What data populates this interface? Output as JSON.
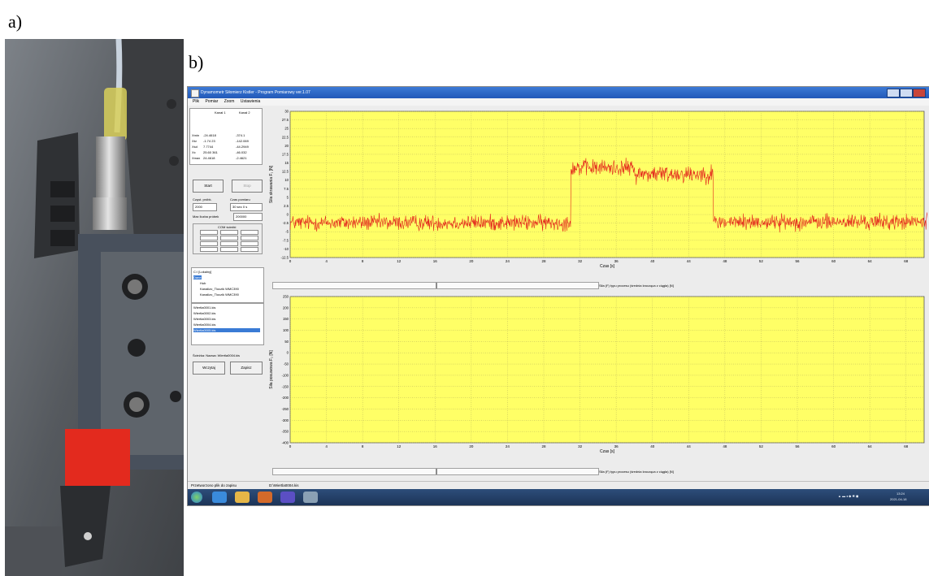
{
  "panels": {
    "a_label": "a)",
    "b_label": "b)"
  },
  "window": {
    "title": "Dynamometr Siłomierz Kistler - Program Pomiarowy  ver.1.07",
    "menu": [
      "Plik",
      "Pomiar",
      "Zoom",
      "Ustawienia"
    ]
  },
  "left_panel": {
    "channel_headers": [
      "Kanał 1",
      "Kanał 2"
    ],
    "stats_rows": [
      {
        "label": "Xmin",
        "ch1": "-24.4618",
        "ch2": "-374.1"
      },
      {
        "label": "Xśr",
        "ch1": "-1.74 23",
        "ch2": "-142.069"
      },
      {
        "label": "Xsd",
        "ch1": "7.7744",
        "ch2": "-44.2949"
      },
      {
        "label": "Xx",
        "ch1": "25.60 361",
        "ch2": "-46.032"
      },
      {
        "label": "Xmax",
        "ch1": "24.4618",
        "ch2": "-2.4621"
      }
    ],
    "start_button": "Start",
    "stop_button": "Stop",
    "sampling_label": "Częst. próbk.",
    "sampling_value": "2000",
    "duration_label": "Czas pomiaru",
    "duration_value": "30 sec 0 s",
    "max_samples_label": "Max liczba próbek",
    "max_samples_value": "200000",
    "com_label": "COM ścieżki",
    "file_tree": [
      "C:\\ [Lokalny]",
      "Dane",
      "Hub",
      "Kanalizo_Tloczik WMC390",
      "Kanalizo_Tloczik WMC390"
    ],
    "file_list": [
      "Wiertla0001.kis",
      "Wiertla0002.kis",
      "Wiertla0003.kis",
      "Wiertla0004.kis",
      "Wiertla0005.kis"
    ],
    "file_name_label": "Ścieżka: Nazwa: Wiertla0004.kis",
    "read_button": "Wczytaj",
    "save_button": "Zapisz"
  },
  "status": {
    "left": "Przetworzono plik do zapisu",
    "right": "D:\\Wiertla0004.kis"
  },
  "taskbar": {
    "time": "13:24",
    "date": "2021-04-18"
  },
  "chart_data": [
    {
      "type": "line",
      "title": "",
      "xlabel": "Czas [s]",
      "ylabel": "Siła skrawania F₁ [N]",
      "xlim": [
        0,
        70
      ],
      "ylim": [
        -12.5,
        30
      ],
      "xticks": [
        0,
        4,
        8,
        12,
        16,
        20,
        24,
        28,
        32,
        36,
        40,
        44,
        48,
        52,
        56,
        60,
        64,
        68
      ],
      "yticks": [
        -12.5,
        -10,
        -7.5,
        -5,
        -2.5,
        0,
        2.5,
        5,
        7.5,
        10,
        12.5,
        15,
        17.5,
        20,
        22.5,
        25,
        27.5,
        30
      ],
      "background": "#ffff66",
      "line_color": "#e3261c",
      "caption": "Siła (F) typu procesu (średnia krocząca z ciągła) [N]",
      "segments": [
        {
          "x_start": 0.0,
          "x_end": 31.0,
          "mean": -2.4,
          "noise": 1.6
        },
        {
          "x_start": 31.0,
          "x_end": 38.0,
          "mean": 13.6,
          "noise": 1.7
        },
        {
          "x_start": 38.0,
          "x_end": 46.7,
          "mean": 11.8,
          "noise": 1.8
        },
        {
          "x_start": 46.7,
          "x_end": 72.0,
          "mean": -2.2,
          "noise": 1.6
        }
      ],
      "grid": true
    },
    {
      "type": "line",
      "title": "",
      "xlabel": "Czas [s]",
      "ylabel": "Siła posuwowa F₂ [N]",
      "xlim": [
        0,
        70
      ],
      "ylim": [
        -400,
        250
      ],
      "xticks": [
        0,
        4,
        8,
        12,
        16,
        20,
        24,
        28,
        32,
        36,
        40,
        44,
        48,
        52,
        56,
        60,
        64,
        68
      ],
      "yticks": [
        -400,
        -350,
        -300,
        -250,
        -200,
        -150,
        -100,
        -50,
        0,
        50,
        100,
        150,
        200,
        250
      ],
      "background": "#ffff66",
      "line_color": "#e3261c",
      "caption": "Siła (F) typu procesu (średnia krocząca z ciągła) [N]",
      "grid": true
    }
  ]
}
